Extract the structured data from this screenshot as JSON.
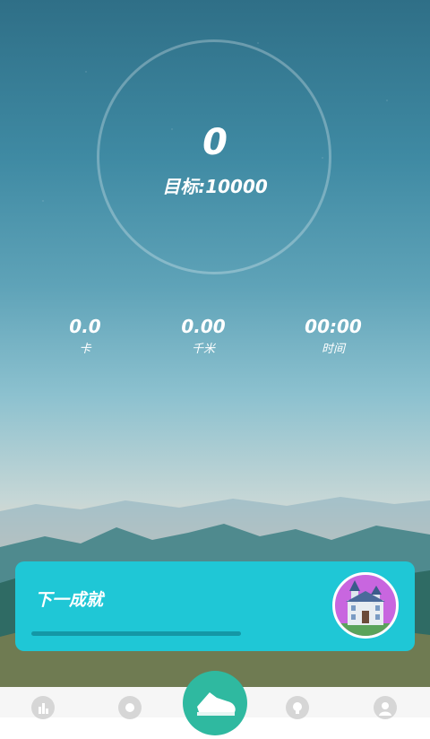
{
  "pedometer": {
    "steps": "0",
    "goal": "目标:10000"
  },
  "stats": [
    {
      "value": "0.0",
      "label": "卡"
    },
    {
      "value": "0.00",
      "label": "千米"
    },
    {
      "value": "00:00",
      "label": "时间"
    }
  ],
  "achievement": {
    "title": "下一成就",
    "progress": 0.0
  },
  "nav": [
    {
      "icon": "chart-icon"
    },
    {
      "icon": "medal-icon"
    },
    {
      "icon": "shoe-icon"
    },
    {
      "icon": "lightbulb-icon"
    },
    {
      "icon": "profile-icon"
    }
  ],
  "colors": {
    "card": "#1fc7d6",
    "nav_active": "#2fb9a0",
    "badge": "#c866df"
  }
}
